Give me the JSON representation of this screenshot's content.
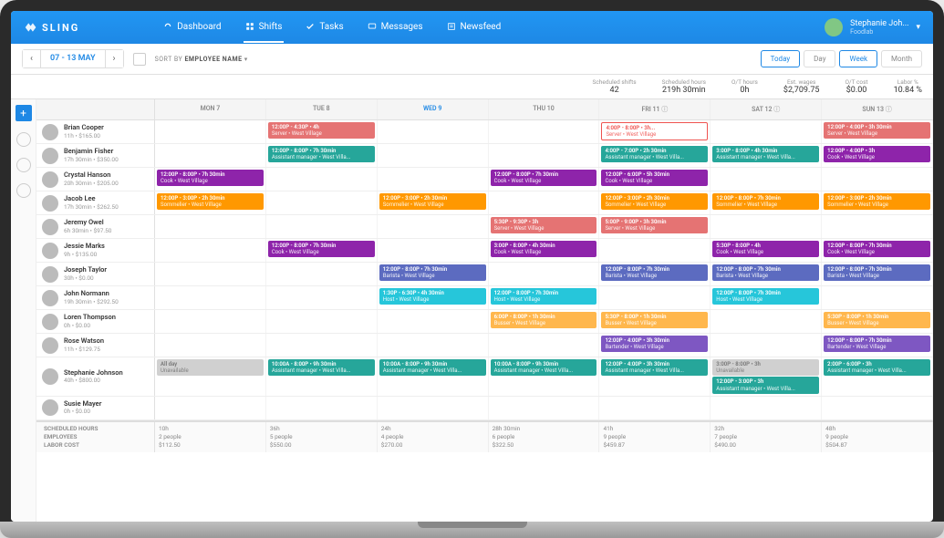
{
  "app": {
    "name": "SLING"
  },
  "nav": {
    "dashboard": "Dashboard",
    "shifts": "Shifts",
    "tasks": "Tasks",
    "messages": "Messages",
    "newsfeed": "Newsfeed"
  },
  "user": {
    "name": "Stephanie Joh...",
    "org": "Foodlab"
  },
  "toolbar": {
    "range": "07 - 13 MAY",
    "sort_label": "SORT BY",
    "sort_value": "EMPLOYEE NAME",
    "today": "Today",
    "day": "Day",
    "week": "Week",
    "month": "Month"
  },
  "stats": {
    "scheduled_shifts": {
      "lbl": "Scheduled shifts",
      "val": "42"
    },
    "scheduled_hours": {
      "lbl": "Scheduled hours",
      "val": "219h 30min"
    },
    "ot_hours": {
      "lbl": "O/T hours",
      "val": "0h"
    },
    "est_wages": {
      "lbl": "Est. wages",
      "val": "$2,709.75"
    },
    "ot_cost": {
      "lbl": "O/T cost",
      "val": "$0.00"
    },
    "labor_pct": {
      "lbl": "Labor %",
      "val": "10.84 %"
    }
  },
  "days": [
    "MON 7",
    "TUE 8",
    "WED 9",
    "THU 10",
    "FRI 11",
    "SAT 12",
    "SUN 13"
  ],
  "active_day_index": 2,
  "colors": {
    "server": "#e57373",
    "asst": "#26a69a",
    "sommelier": "#ff9800",
    "cook": "#8e24aa",
    "barista": "#5c6bc0",
    "host": "#26c6da",
    "busser": "#ffb74d",
    "bartender": "#7e57c2",
    "unavail": "#d0d0d0",
    "outline": "#ef5350"
  },
  "employees": [
    {
      "name": "Brian Cooper",
      "sub": "11h • $165.00",
      "shifts": {
        "1": [
          {
            "c": "server",
            "t": "12:00P - 4:30P • 4h",
            "r": "Server • West Village"
          }
        ],
        "4": [
          {
            "c": "outline",
            "t": "4:00P - 8:00P • 3h...",
            "r": "Server • West Village"
          }
        ],
        "6": [
          {
            "c": "server",
            "t": "12:00P - 4:00P • 3h 30min",
            "r": "Server • West Village"
          }
        ]
      }
    },
    {
      "name": "Benjamin Fisher",
      "sub": "17h 30min • $350.00",
      "shifts": {
        "1": [
          {
            "c": "asst",
            "t": "12:00P - 8:00P • 7h 30min",
            "r": "Assistant manager • West Villa..."
          }
        ],
        "4": [
          {
            "c": "asst",
            "t": "4:00P - 7:00P • 2h 30min",
            "r": "Assistant manager • West Villa..."
          }
        ],
        "5": [
          {
            "c": "asst",
            "t": "3:00P - 8:00P • 4h 30min",
            "r": "Assistant manager • West Villa..."
          }
        ],
        "6": [
          {
            "c": "cook",
            "t": "12:00P - 4:00P • 3h",
            "r": "Cook • West Village"
          }
        ]
      }
    },
    {
      "name": "Crystal Hanson",
      "sub": "20h 30min • $205.00",
      "shifts": {
        "0": [
          {
            "c": "cook",
            "t": "12:00P - 8:00P • 7h 30min",
            "r": "Cook • West Village"
          }
        ],
        "3": [
          {
            "c": "cook",
            "t": "12:00P - 8:00P • 7h 30min",
            "r": "Cook • West Village"
          }
        ],
        "4": [
          {
            "c": "cook",
            "t": "12:00P - 6:00P • 5h 30min",
            "r": "Cook • West Village"
          }
        ]
      }
    },
    {
      "name": "Jacob Lee",
      "sub": "17h 30min • $262.50",
      "shifts": {
        "0": [
          {
            "c": "sommelier",
            "t": "12:00P - 3:00P • 2h 30min",
            "r": "Sommelier • West Village"
          }
        ],
        "2": [
          {
            "c": "sommelier",
            "t": "12:00P - 3:00P • 2h 30min",
            "r": "Sommelier • West Village"
          }
        ],
        "4": [
          {
            "c": "sommelier",
            "t": "12:00P - 3:00P • 2h 30min",
            "r": "Sommelier • West Village"
          }
        ],
        "5": [
          {
            "c": "sommelier",
            "t": "12:00P - 8:00P • 7h 30min",
            "r": "Sommelier • West Village"
          }
        ],
        "6": [
          {
            "c": "sommelier",
            "t": "12:00P - 3:00P • 2h 30min",
            "r": "Sommelier • West Village"
          }
        ]
      }
    },
    {
      "name": "Jeremy Owel",
      "sub": "6h 30min • $97.50",
      "shifts": {
        "3": [
          {
            "c": "server",
            "t": "5:30P - 9:30P • 3h",
            "r": "Server • West Village"
          }
        ],
        "4": [
          {
            "c": "server",
            "t": "5:00P - 9:00P • 3h 30min",
            "r": "Server • West Village"
          }
        ]
      }
    },
    {
      "name": "Jessie Marks",
      "sub": "9h • $135.00",
      "shifts": {
        "1": [
          {
            "c": "cook",
            "t": "12:00P - 8:00P • 7h 30min",
            "r": "Cook • West Village"
          }
        ],
        "3": [
          {
            "c": "cook",
            "t": "3:00P - 8:00P • 4h 30min",
            "r": "Cook • West Village"
          }
        ],
        "5": [
          {
            "c": "cook",
            "t": "5:30P - 8:00P • 4h",
            "r": "Cook • West Village"
          }
        ],
        "6": [
          {
            "c": "cook",
            "t": "12:00P - 8:00P • 7h 30min",
            "r": "Cook • West Village"
          }
        ]
      }
    },
    {
      "name": "Joseph Taylor",
      "sub": "30h • $0.00",
      "shifts": {
        "2": [
          {
            "c": "barista",
            "t": "12:00P - 8:00P • 7h 30min",
            "r": "Barista • West Village"
          }
        ],
        "4": [
          {
            "c": "barista",
            "t": "12:00P - 8:00P • 7h 30min",
            "r": "Barista • West Village"
          }
        ],
        "5": [
          {
            "c": "barista",
            "t": "12:00P - 8:00P • 7h 30min",
            "r": "Barista • West Village"
          }
        ],
        "6": [
          {
            "c": "barista",
            "t": "12:00P - 8:00P • 7h 30min",
            "r": "Barista • West Village"
          }
        ]
      }
    },
    {
      "name": "John Normann",
      "sub": "19h 30min • $292.50",
      "shifts": {
        "2": [
          {
            "c": "host",
            "t": "1:30P - 6:30P • 4h 30min",
            "r": "Host • West Village"
          }
        ],
        "3": [
          {
            "c": "host",
            "t": "12:00P - 8:00P • 7h 30min",
            "r": "Host • West Village"
          }
        ],
        "5": [
          {
            "c": "host",
            "t": "12:00P - 8:00P • 7h 30min",
            "r": "Host • West Village"
          }
        ]
      }
    },
    {
      "name": "Loren Thompson",
      "sub": "0h • $0.00",
      "shifts": {
        "3": [
          {
            "c": "busser",
            "t": "6:00P - 8:00P • 1h 30min",
            "r": "Busser • West Village"
          }
        ],
        "4": [
          {
            "c": "busser",
            "t": "5:30P - 8:00P • 1h 30min",
            "r": "Busser • West Village"
          }
        ],
        "6": [
          {
            "c": "busser",
            "t": "5:30P - 8:00P • 1h 30min",
            "r": "Busser • West Village"
          }
        ]
      }
    },
    {
      "name": "Rose Watson",
      "sub": "11h • $129.75",
      "shifts": {
        "4": [
          {
            "c": "bartender",
            "t": "12:00P - 4:00P • 3h 30min",
            "r": "Bartender • West Village"
          }
        ],
        "6": [
          {
            "c": "bartender",
            "t": "12:00P - 8:00P • 7h 30min",
            "r": "Bartender • West Village"
          }
        ]
      }
    },
    {
      "name": "Stephanie Johnson",
      "sub": "40h • $800.00",
      "shifts": {
        "0": [
          {
            "c": "unavail",
            "t": "All day",
            "r": "Unavailable"
          }
        ],
        "1": [
          {
            "c": "asst",
            "t": "10:00A - 8:00P • 9h 30min",
            "r": "Assistant manager • West Villa..."
          }
        ],
        "2": [
          {
            "c": "asst",
            "t": "10:00A - 8:00P • 9h 30min",
            "r": "Assistant manager • West Villa..."
          }
        ],
        "3": [
          {
            "c": "asst",
            "t": "10:00A - 8:00P • 9h 30min",
            "r": "Assistant manager • West Villa..."
          }
        ],
        "4": [
          {
            "c": "asst",
            "t": "12:00P - 4:00P • 3h 30min",
            "r": "Assistant manager • West Villa..."
          }
        ],
        "5": [
          {
            "c": "unavail",
            "t": "3:00P - 8:00P • 3h",
            "r": "Unavailable"
          },
          {
            "c": "asst",
            "t": "12:00P - 3:00P • 3h",
            "r": "Assistant manager • West Villa..."
          }
        ],
        "6": [
          {
            "c": "asst",
            "t": "2:00P - 6:00P • 3h",
            "r": "Assistant manager • West Villa..."
          }
        ]
      }
    },
    {
      "name": "Susie Mayer",
      "sub": "0h • $0.00",
      "shifts": {}
    }
  ],
  "footer": {
    "labels": [
      "SCHEDULED HOURS",
      "EMPLOYEES",
      "LABOR COST"
    ],
    "cols": [
      [
        "10h",
        "2 people",
        "$112.50"
      ],
      [
        "36h",
        "5 people",
        "$550.00"
      ],
      [
        "24h",
        "4 people",
        "$270.00"
      ],
      [
        "28h 30min",
        "6 people",
        "$322.50"
      ],
      [
        "41h",
        "9 people",
        "$459.87"
      ],
      [
        "32h",
        "7 people",
        "$490.00"
      ],
      [
        "48h",
        "9 people",
        "$504.87"
      ]
    ]
  }
}
